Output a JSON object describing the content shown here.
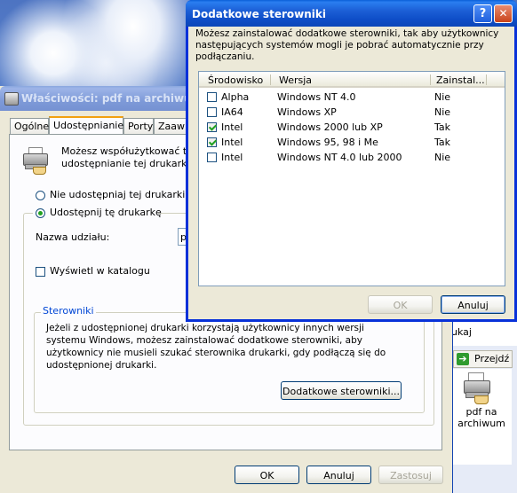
{
  "bg_window": {
    "title": "Właściwości: pdf na archiwum",
    "tabs": [
      "Ogólne",
      "Udostępnianie",
      "Porty",
      "Zaaw"
    ],
    "description": "Możesz współużytkować tej d\nudostępnianie tej drukarki, klik",
    "radio_not_share": "Nie udostępniaj tej drukarki",
    "radio_share": "Udostępnij tę drukarkę",
    "share_name_label": "Nazwa udziału:",
    "share_name_value": "pd",
    "list_in_directory": "Wyświetl w katalogu",
    "drivers_group": {
      "title": "Sterowniki",
      "text": "Jeżeli z udostępnionej drukarki korzystają użytkownicy innych wersji systemu Windows, możesz zainstalować dodatkowe sterowniki, aby użytkownicy nie musieli szukać sterownika drukarki, gdy podłączą się do udostępnionej drukarki.",
      "button": "Dodatkowe sterowniki..."
    },
    "buttons": {
      "ok": "OK",
      "cancel": "Anuluj",
      "apply": "Zastosuj"
    }
  },
  "dialog": {
    "title": "Dodatkowe sterowniki",
    "help_btn": "?",
    "close_btn": "✕",
    "description": "Możesz zainstalować dodatkowe sterowniki, tak aby użytkownicy następujących systemów mogli je pobrać automatycznie przy podłączaniu.",
    "columns": [
      "Środowisko",
      "Wersja",
      "Zainstal..."
    ],
    "rows": [
      {
        "env": "Alpha",
        "version": "Windows NT 4.0",
        "installed": "Nie",
        "checked": false
      },
      {
        "env": "IA64",
        "version": "Windows XP",
        "installed": "Nie",
        "checked": false
      },
      {
        "env": "Intel",
        "version": "Windows 2000 lub XP",
        "installed": "Tak",
        "checked": true
      },
      {
        "env": "Intel",
        "version": "Windows 95, 98 i Me",
        "installed": "Tak",
        "checked": true
      },
      {
        "env": "Intel",
        "version": "Windows NT 4.0 lub 2000",
        "installed": "Nie",
        "checked": false
      }
    ],
    "buttons": {
      "ok": "OK",
      "cancel": "Anuluj"
    }
  },
  "side_panel": {
    "partial_text": "ukaj",
    "go_button": "Przejdź",
    "printer_label": "pdf na\narchiwum"
  }
}
